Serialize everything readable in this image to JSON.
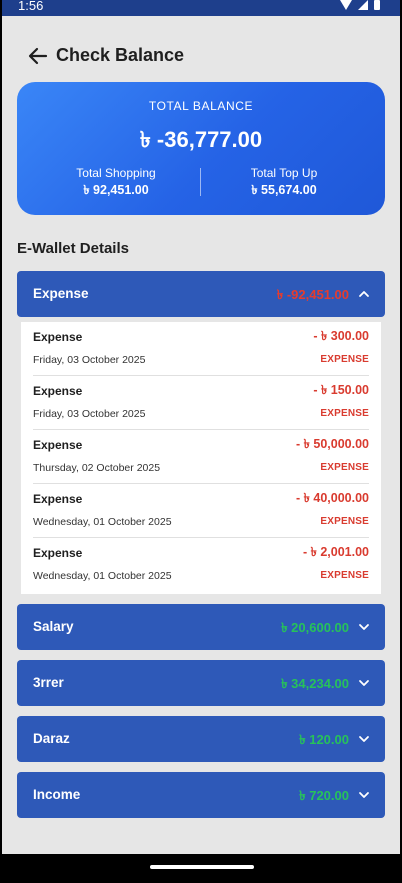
{
  "status_bar": {
    "time": "1:56"
  },
  "header": {
    "title": "Check Balance"
  },
  "balance_card": {
    "total_label": "TOTAL BALANCE",
    "total_value": "৳ -36,777.00",
    "shopping_label": "Total Shopping",
    "shopping_value": "৳ 92,451.00",
    "topup_label": "Total Top Up",
    "topup_value": "৳ 55,674.00"
  },
  "section_title": "E-Wallet Details",
  "colors": {
    "accordion_bg": "#2e59b8",
    "negative": "#e63c2e",
    "positive": "#27c25a",
    "card_gradient_start": "#3a86f7",
    "card_gradient_end": "#1f58d8"
  },
  "wallets": [
    {
      "title": "Expense",
      "amount": "৳ -92,451.00",
      "type": "negative",
      "expanded": true,
      "icon": "chevron-up-icon"
    },
    {
      "title": "Salary",
      "amount": "৳ 20,600.00",
      "type": "positive",
      "expanded": false,
      "icon": "chevron-down-icon"
    },
    {
      "title": "3rrer",
      "amount": "৳ 34,234.00",
      "type": "positive",
      "expanded": false,
      "icon": "chevron-down-icon"
    },
    {
      "title": "Daraz",
      "amount": "৳ 120.00",
      "type": "positive",
      "expanded": false,
      "icon": "chevron-down-icon"
    },
    {
      "title": "Income",
      "amount": "৳ 720.00",
      "type": "positive",
      "expanded": false,
      "icon": "chevron-down-icon"
    }
  ],
  "transactions": [
    {
      "name": "Expense",
      "amount": "- ৳ 300.00",
      "date": "Friday, 03 October 2025",
      "type": "EXPENSE"
    },
    {
      "name": "Expense",
      "amount": "- ৳ 150.00",
      "date": "Friday, 03 October 2025",
      "type": "EXPENSE"
    },
    {
      "name": "Expense",
      "amount": "- ৳ 50,000.00",
      "date": "Thursday, 02 October 2025",
      "type": "EXPENSE"
    },
    {
      "name": "Expense",
      "amount": "- ৳ 40,000.00",
      "date": "Wednesday, 01 October 2025",
      "type": "EXPENSE"
    },
    {
      "name": "Expense",
      "amount": "- ৳ 2,001.00",
      "date": "Wednesday, 01 October 2025",
      "type": "EXPENSE"
    }
  ]
}
